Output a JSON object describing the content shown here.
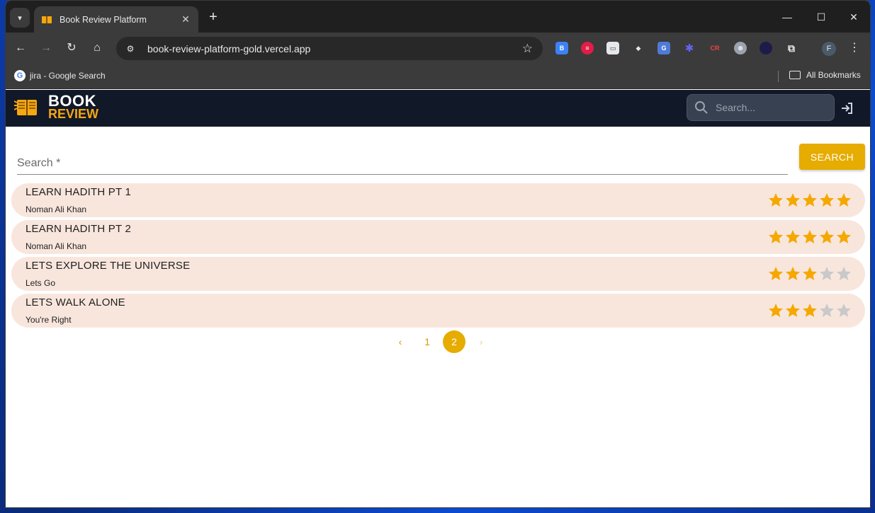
{
  "browser": {
    "tab_title": "Book Review Platform",
    "url": "book-review-platform-gold.vercel.app",
    "bookmark": "jira - Google Search",
    "all_bookmarks": "All Bookmarks",
    "profile_initial": "F"
  },
  "app": {
    "logo_top": "BOOK",
    "logo_bottom": "REVIEW",
    "header_search_placeholder": "Search...",
    "main_search_placeholder": "Search *",
    "search_button": "SEARCH"
  },
  "books": [
    {
      "title": "LEARN HADITH PT 1",
      "author": "Noman Ali Khan",
      "rating": 5
    },
    {
      "title": "LEARN HADITH PT 2",
      "author": "Noman Ali Khan",
      "rating": 5
    },
    {
      "title": "LETS EXPLORE THE UNIVERSE",
      "author": "Lets Go",
      "rating": 3
    },
    {
      "title": "LETS WALK ALONE",
      "author": "You're Right",
      "rating": 3
    }
  ],
  "pagination": {
    "pages": [
      "1",
      "2"
    ],
    "current": "2"
  },
  "colors": {
    "accent": "#e6ac00",
    "row_bg": "#f8e6dd",
    "star_on": "#f5a800",
    "star_off": "#c9c9c9"
  }
}
